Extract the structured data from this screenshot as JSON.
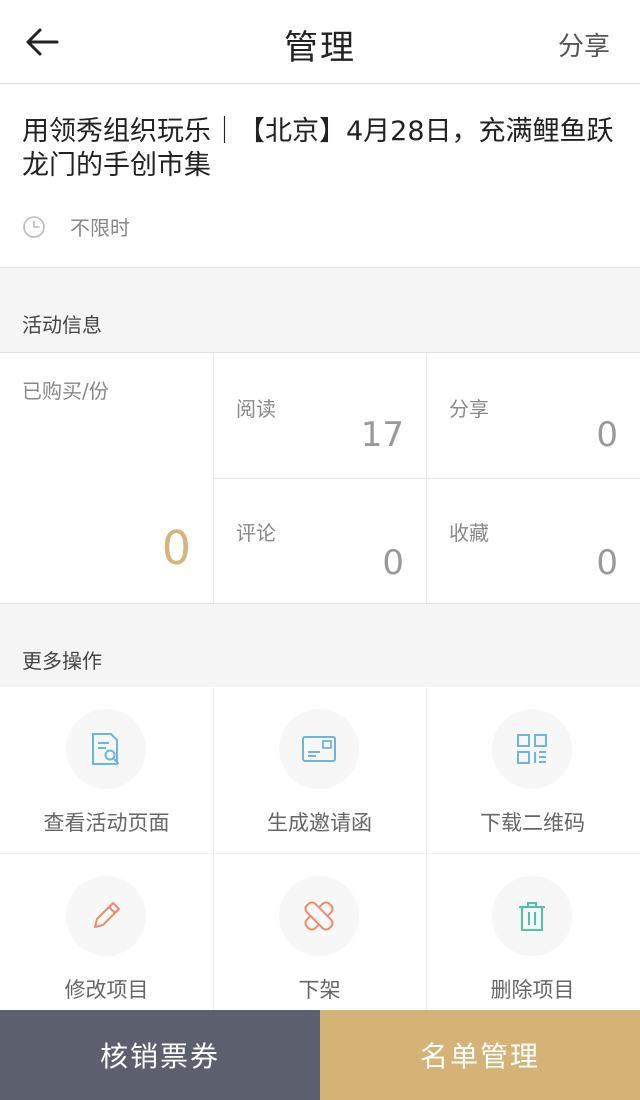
{
  "header": {
    "title": "管理",
    "share_label": "分享",
    "back_icon": "arrow-left-icon"
  },
  "event": {
    "name": "用领秀组织玩乐｜【北京】4月28日，充满鲤鱼跃龙门的手创市集",
    "time_text": "不限时",
    "time_icon": "clock-icon"
  },
  "activity_info": {
    "heading": "活动信息",
    "purchased": {
      "label": "已购买/份",
      "value": "0"
    },
    "reads": {
      "label": "阅读",
      "value": "17"
    },
    "shares": {
      "label": "分享",
      "value": "0"
    },
    "comments": {
      "label": "评论",
      "value": "0"
    },
    "favorites": {
      "label": "收藏",
      "value": "0"
    }
  },
  "more_ops": {
    "heading": "更多操作",
    "items": [
      {
        "label": "查看活动页面",
        "icon": "document-search-icon",
        "color": "#6cb6de"
      },
      {
        "label": "生成邀请函",
        "icon": "invitation-card-icon",
        "color": "#6cb6de"
      },
      {
        "label": "下载二维码",
        "icon": "qrcode-icon",
        "color": "#6cb6de"
      },
      {
        "label": "修改项目",
        "icon": "pencil-icon",
        "color": "#ef8b6d"
      },
      {
        "label": "下架",
        "icon": "bandage-icon",
        "color": "#ef8b6d"
      },
      {
        "label": "删除项目",
        "icon": "trash-icon",
        "color": "#4dc2a6"
      }
    ]
  },
  "bottom_bar": {
    "verify_label": "核销票券",
    "list_label": "名单管理"
  },
  "colors": {
    "accent_gold": "#d5b276",
    "dark_button": "#5c5f6e",
    "purchased_value": "#d6b47a"
  }
}
